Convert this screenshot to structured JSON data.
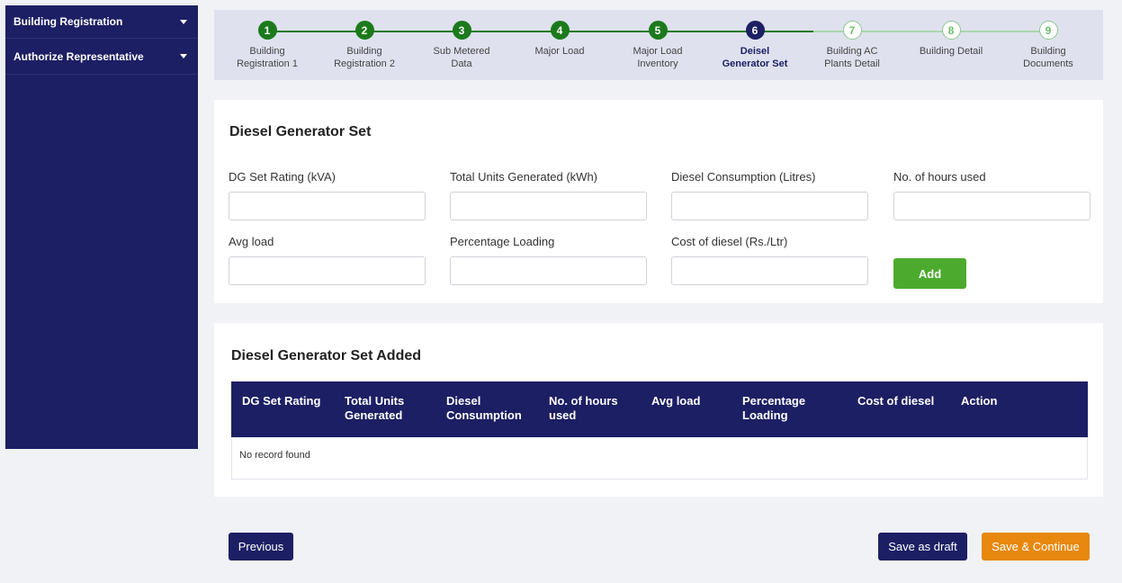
{
  "sidebar": {
    "items": [
      {
        "label": "Building Registration"
      },
      {
        "label": "Authorize Representative"
      }
    ]
  },
  "stepper": {
    "steps": [
      {
        "num": "1",
        "line1": "Building",
        "line2": "Registration 1",
        "state": "done"
      },
      {
        "num": "2",
        "line1": "Building",
        "line2": "Registration 2",
        "state": "done"
      },
      {
        "num": "3",
        "line1": "Sub Metered",
        "line2": "Data",
        "state": "done"
      },
      {
        "num": "4",
        "line1": "Major Load",
        "line2": "",
        "state": "done"
      },
      {
        "num": "5",
        "line1": "Major Load",
        "line2": "Inventory",
        "state": "done"
      },
      {
        "num": "6",
        "line1": "Deisel",
        "line2": "Generator Set",
        "state": "active"
      },
      {
        "num": "7",
        "line1": "Building AC",
        "line2": "Plants Detail",
        "state": "todo"
      },
      {
        "num": "8",
        "line1": "Building Detail",
        "line2": "",
        "state": "todo"
      },
      {
        "num": "9",
        "line1": "Building",
        "line2": "Documents",
        "state": "todo"
      }
    ]
  },
  "form": {
    "title": "Diesel Generator Set",
    "fields": {
      "dg_rating": {
        "label": "DG Set Rating (kVA)",
        "value": ""
      },
      "total_units": {
        "label": "Total Units Generated (kWh)",
        "value": ""
      },
      "diesel_consumption": {
        "label": "Diesel Consumption (Litres)",
        "value": ""
      },
      "hours_used": {
        "label": "No. of hours used",
        "value": ""
      },
      "avg_load": {
        "label": "Avg load",
        "value": ""
      },
      "percentage_loading": {
        "label": "Percentage Loading",
        "value": ""
      },
      "cost_diesel": {
        "label": "Cost of diesel (Rs./Ltr)",
        "value": ""
      }
    },
    "add_label": "Add"
  },
  "table": {
    "title": "Diesel Generator Set Added",
    "columns": [
      {
        "line1": "DG Set Rating",
        "line2": ""
      },
      {
        "line1": "Total Units",
        "line2": "Generated"
      },
      {
        "line1": "Diesel",
        "line2": "Consumption"
      },
      {
        "line1": "No. of hours",
        "line2": "used"
      },
      {
        "line1": "Avg load",
        "line2": ""
      },
      {
        "line1": "Percentage",
        "line2": "Loading"
      },
      {
        "line1": "Cost of diesel",
        "line2": ""
      },
      {
        "line1": "Action",
        "line2": ""
      }
    ],
    "empty_text": "No record found"
  },
  "footer": {
    "previous_label": "Previous",
    "draft_label": "Save as draft",
    "save_label": "Save & Continue"
  },
  "colors": {
    "navy": "#1c1f63",
    "green_done": "#1c7a1c",
    "green_add": "#4cab2e",
    "orange": "#e8880e"
  }
}
